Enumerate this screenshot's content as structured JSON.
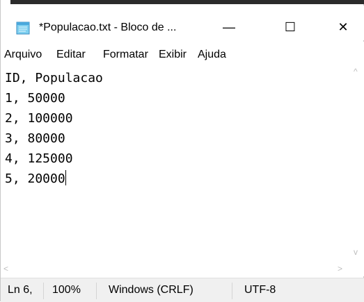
{
  "window": {
    "title": "*Populacao.txt - Bloco de ...",
    "minimize_glyph": "—",
    "maximize_glyph": "☐",
    "close_glyph": "✕",
    "app_icon": "notepad-icon"
  },
  "menu": {
    "items": [
      "Arquivo",
      "Editar",
      "Formatar",
      "Exibir",
      "Ajuda"
    ]
  },
  "editor": {
    "content": "ID, Populacao\n1, 50000\n2, 100000\n3, 80000\n4, 125000\n5, 20000"
  },
  "scrollbars": {
    "up_icon": "^",
    "down_icon": "v",
    "left_icon": "<",
    "right_icon": ">"
  },
  "status": {
    "position": "Ln 6,",
    "zoom": "100%",
    "line_ending": "Windows (CRLF)",
    "encoding": "UTF-8"
  }
}
